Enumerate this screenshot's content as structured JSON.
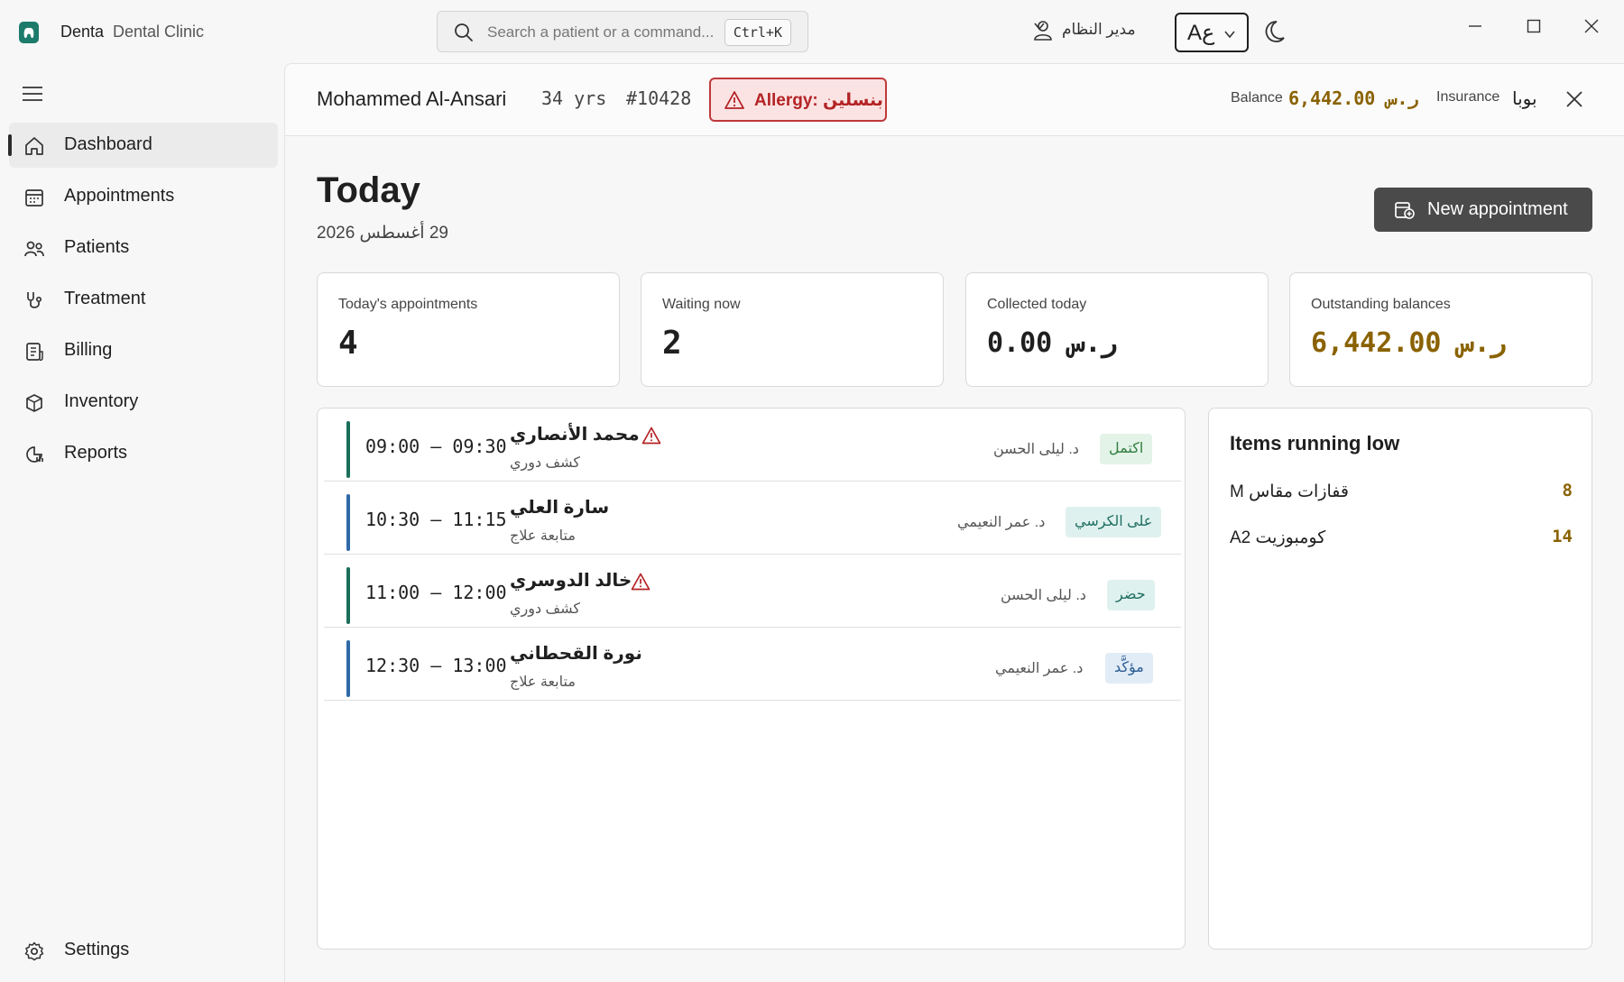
{
  "app": {
    "name": "Denta",
    "subtitle": "Dental Clinic"
  },
  "search": {
    "placeholder": "Search a patient or a command...",
    "shortcut": "Ctrl+K"
  },
  "user": {
    "name": "مدير النظام"
  },
  "language": {
    "glyph": "Aع"
  },
  "sidebar": {
    "items": [
      {
        "label": "Dashboard",
        "icon": "home-icon",
        "active": true
      },
      {
        "label": "Appointments",
        "icon": "calendar-icon",
        "active": false
      },
      {
        "label": "Patients",
        "icon": "people-icon",
        "active": false
      },
      {
        "label": "Treatment",
        "icon": "stethoscope-icon",
        "active": false
      },
      {
        "label": "Billing",
        "icon": "receipt-icon",
        "active": false
      },
      {
        "label": "Inventory",
        "icon": "box-icon",
        "active": false
      },
      {
        "label": "Reports",
        "icon": "chart-icon",
        "active": false
      }
    ],
    "settings_label": "Settings"
  },
  "patient": {
    "name": "Mohammed Al-Ansari",
    "age": "34 yrs",
    "id": "#10428",
    "allergy": "Allergy: بنسلين",
    "balance_label": "Balance",
    "balance_value": "ر.س 6,442.00",
    "insurance_label": "Insurance",
    "insurance_value": "بوبا"
  },
  "page": {
    "title": "Today",
    "date": "29 أغسطس 2026",
    "new_appointment_label": "New appointment"
  },
  "stats": [
    {
      "label": "Today's appointments",
      "value": "4"
    },
    {
      "label": "Waiting now",
      "value": "2"
    },
    {
      "label": "Collected today",
      "value": "ر.س 0.00"
    },
    {
      "label": "Outstanding balances",
      "value": "ر.س 6,442.00"
    }
  ],
  "appointments": [
    {
      "time": "09:00 – 09:30",
      "name": "محمد الأنصاري",
      "type": "كشف دوري",
      "doctor": "د. ليلى الحسن",
      "status": "اكتمل",
      "alert": true,
      "bar_color": "#1b6e5a",
      "status_bg": "#e3f3e8",
      "status_fg": "#2f7d3f"
    },
    {
      "time": "10:30 – 11:15",
      "name": "سارة العلي",
      "type": "متابعة علاج",
      "doctor": "د. عمر النعيمي",
      "status": "على الكرسي",
      "alert": false,
      "bar_color": "#2f69a8",
      "status_bg": "#dff1ee",
      "status_fg": "#1f6f63"
    },
    {
      "time": "11:00 – 12:00",
      "name": "خالد الدوسري",
      "type": "كشف دوري",
      "doctor": "د. ليلى الحسن",
      "status": "حضر",
      "alert": true,
      "bar_color": "#1b6e5a",
      "status_bg": "#dff1ee",
      "status_fg": "#1f6f63"
    },
    {
      "time": "12:30 – 13:00",
      "name": "نورة القحطاني",
      "type": "متابعة علاج",
      "doctor": "د. عمر النعيمي",
      "status": "مؤكَّد",
      "alert": false,
      "bar_color": "#2f69a8",
      "status_bg": "#e1ecf7",
      "status_fg": "#2b5d93"
    }
  ],
  "low_stock": {
    "title": "Items running low",
    "items": [
      {
        "name": "قفازات مقاس M",
        "qty": "8"
      },
      {
        "name": "كومبوزيت A2",
        "qty": "14"
      }
    ]
  },
  "colors": {
    "accent_gold": "#8a6200",
    "alert_red": "#b42325",
    "primary_dark": "#4a4a4a"
  }
}
